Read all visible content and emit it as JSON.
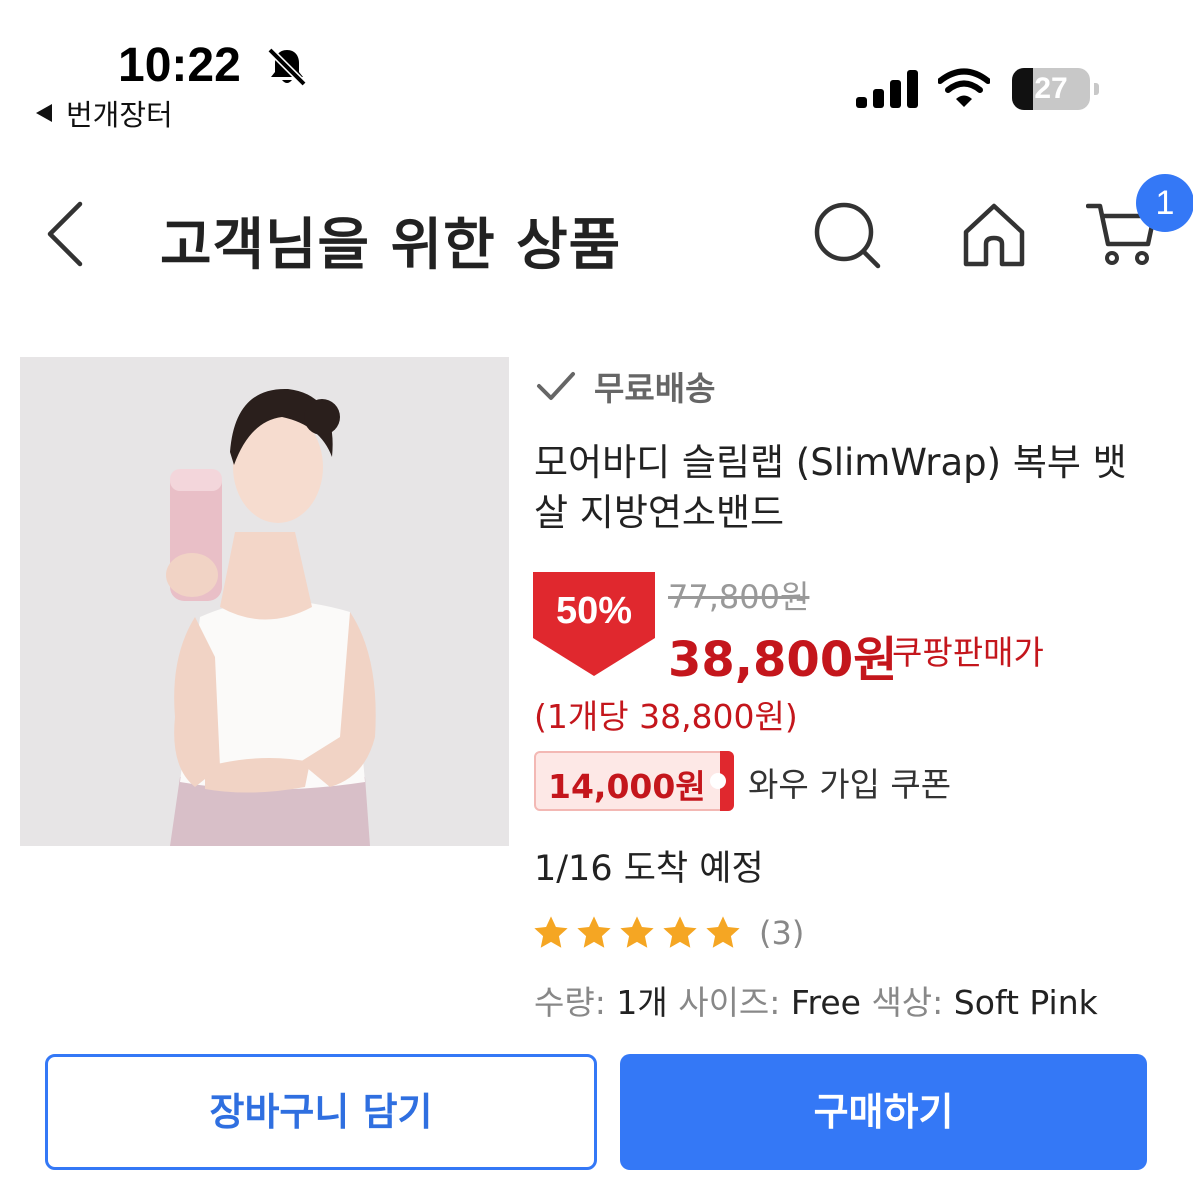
{
  "status_bar": {
    "time": "10:22",
    "back_app": "번개장터",
    "battery": "27",
    "battery_level": 0.27
  },
  "header": {
    "title": "고객님을 위한 상품",
    "cart_count": "1"
  },
  "product": {
    "shipping": "무료배송",
    "name": "모어바디 슬림랩 (SlimWrap) 복부 뱃살 지방연소밴드",
    "discount": "50%",
    "original_price": "77,800원",
    "sale_price": "38,800원",
    "sale_label": "쿠팡판매가",
    "unit_price": "(1개당 38,800원)",
    "coupon_amount": "14,000원",
    "coupon_text": "와우 가입 쿠폰",
    "arrival": "1/16 도착 예정",
    "rating": 5,
    "rating_count": "(3)",
    "options": {
      "qty_label": "수량:",
      "qty_value": "1개",
      "size_label": "사이즈:",
      "size_value": "Free",
      "color_label": "색상:",
      "color_value": "Soft Pink"
    }
  },
  "actions": {
    "add_to_cart": "장바구니 담기",
    "buy_now": "구매하기"
  },
  "colors": {
    "accent_blue": "#3478f6",
    "price_red": "#c4161c",
    "star_yellow": "#f5a623"
  }
}
